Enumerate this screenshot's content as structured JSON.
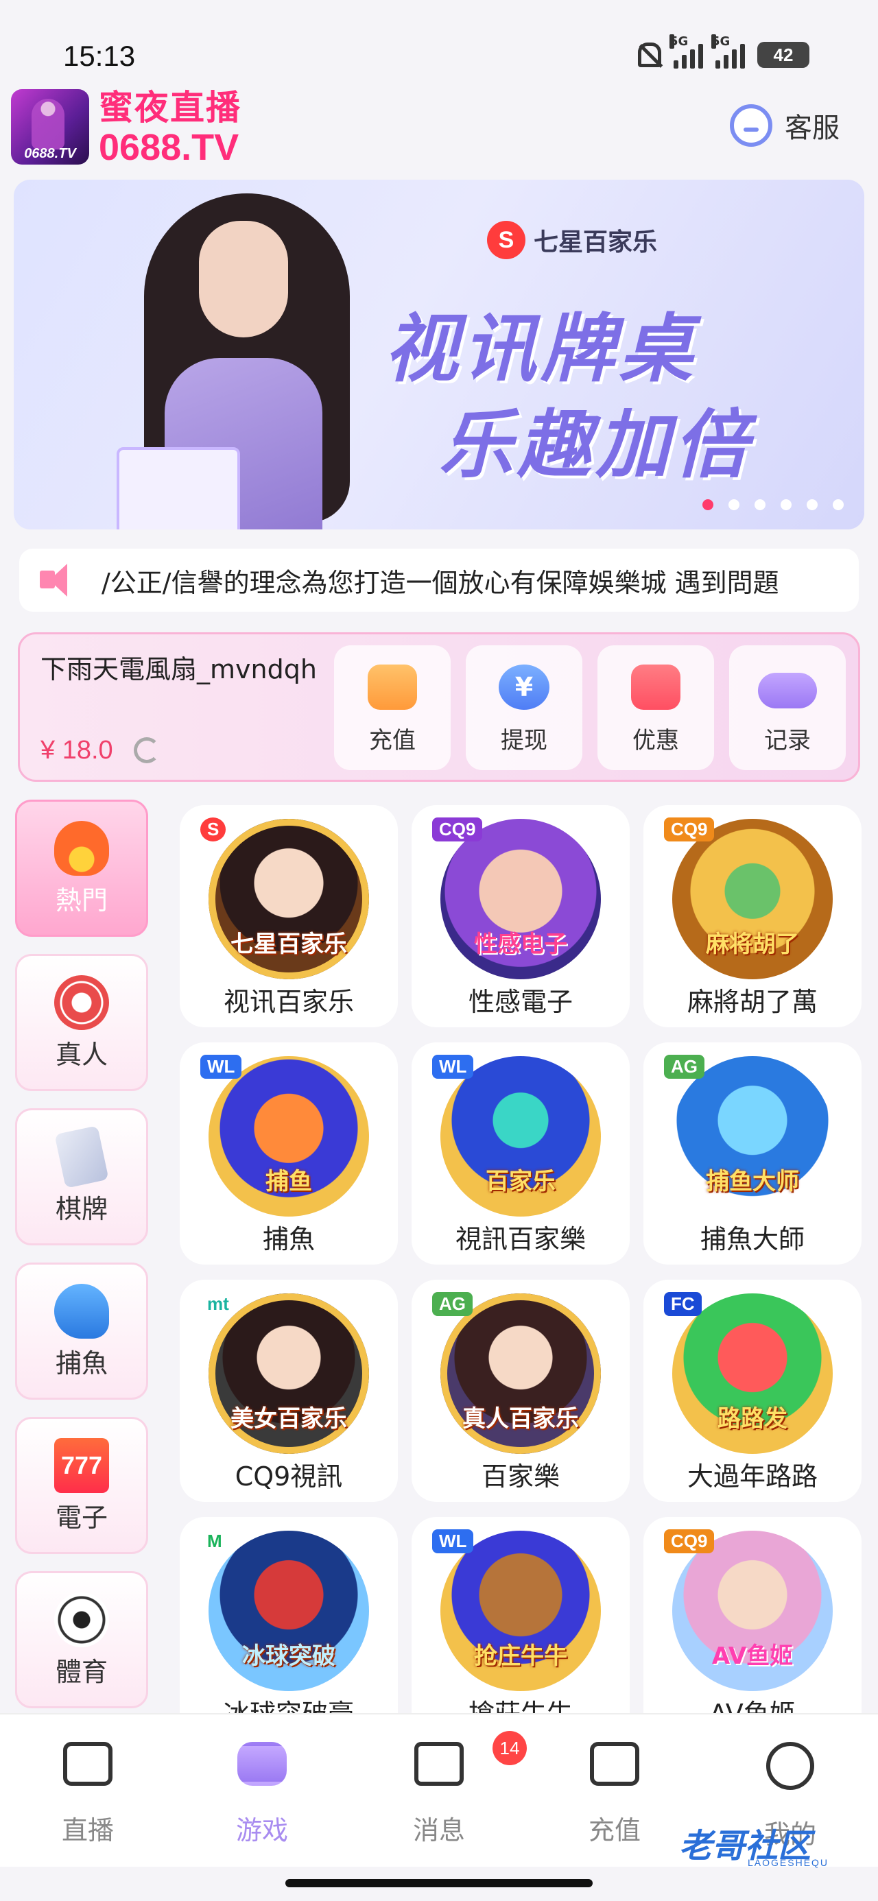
{
  "status_bar": {
    "time": "15:13",
    "signal1": "5G",
    "signal2": "5G",
    "battery": "42"
  },
  "header": {
    "logo_small": "0688.TV",
    "title_cn": "蜜夜直播",
    "title_en": "0688.TV",
    "service_label": "客服"
  },
  "banner": {
    "brand": "七星百家乐",
    "line1": "视讯牌桌",
    "line2": "乐趣加倍",
    "active_dot": 0,
    "dot_count": 6
  },
  "marquee": {
    "text": "/公正/信譽的理念為您打造一個放心有保障娛樂城  遇到問題"
  },
  "wallet": {
    "user_name": "下雨天電風扇_mvndqh",
    "balance": "¥ 18.0",
    "buttons": [
      {
        "label": "充值",
        "icon": "wallet-icon"
      },
      {
        "label": "提现",
        "icon": "yuan-icon"
      },
      {
        "label": "优惠",
        "icon": "ticket-icon"
      },
      {
        "label": "记录",
        "icon": "gamepad-icon"
      }
    ]
  },
  "categories": [
    {
      "label": "熱門",
      "icon": "fire-icon",
      "active": true
    },
    {
      "label": "真人",
      "icon": "chip-icon",
      "active": false
    },
    {
      "label": "棋牌",
      "icon": "cards-icon",
      "active": false
    },
    {
      "label": "捕魚",
      "icon": "shark-icon",
      "active": false
    },
    {
      "label": "電子",
      "icon": "slot-777-icon",
      "active": false
    },
    {
      "label": "體育",
      "icon": "soccer-ball-icon",
      "active": false
    }
  ],
  "games": [
    {
      "name": "视讯百家乐",
      "art_title": "七星百家乐",
      "badge": "S"
    },
    {
      "name": "性感電子",
      "art_title": "性感电子",
      "badge": "CQ9"
    },
    {
      "name": "麻將胡了萬",
      "art_title": "麻将胡了",
      "badge": "CQ9"
    },
    {
      "name": "捕魚",
      "art_title": "捕鱼",
      "badge": "WL"
    },
    {
      "name": "視訊百家樂",
      "art_title": "百家乐",
      "badge": "WL"
    },
    {
      "name": "捕魚大師",
      "art_title": "捕鱼大师",
      "badge": "AG"
    },
    {
      "name": "CQ9視訊",
      "art_title": "美女百家乐",
      "badge": "mt"
    },
    {
      "name": "百家樂",
      "art_title": "真人百家乐",
      "badge": "AG"
    },
    {
      "name": "大過年路路",
      "art_title": "路路发",
      "badge": "FC"
    },
    {
      "name": "冰球突破豪",
      "art_title": "冰球突破",
      "badge": "M"
    },
    {
      "name": "搶莊牛牛",
      "art_title": "抢庄牛牛",
      "badge": "WL"
    },
    {
      "name": "AV鱼姬",
      "art_title": "AV鱼姬",
      "badge": "CQ9"
    }
  ],
  "bottom_nav": [
    {
      "label": "直播",
      "icon": "camera-icon",
      "active": false
    },
    {
      "label": "游戏",
      "icon": "gamepad-icon",
      "active": true
    },
    {
      "label": "消息",
      "icon": "chat-icon",
      "active": false,
      "badge": "14"
    },
    {
      "label": "充值",
      "icon": "wallet-icon",
      "active": false
    },
    {
      "label": "我的",
      "icon": "face-icon",
      "active": false
    }
  ],
  "watermark": {
    "main": "老哥社区",
    "sub": "LAOGESHEQU"
  },
  "colors": {
    "accent_pink": "#ff2d7a",
    "accent_purple": "#a88cf0",
    "badge_red": "#ff4545"
  }
}
